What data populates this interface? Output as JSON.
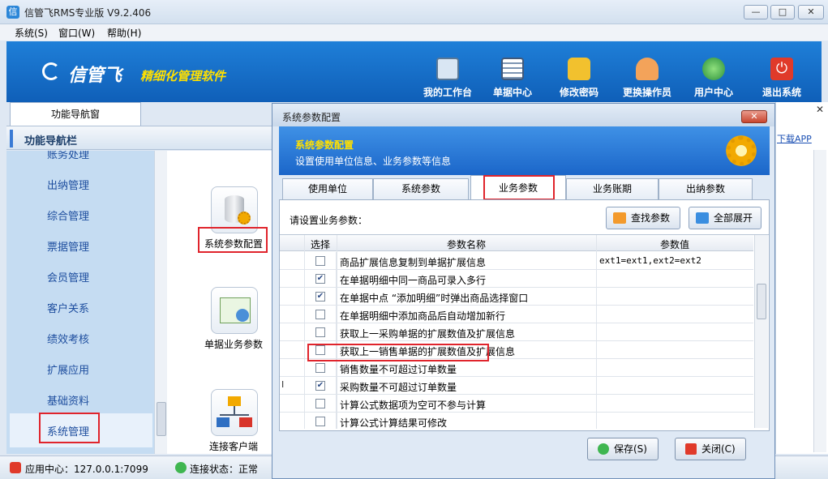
{
  "window": {
    "title": "信管飞RMS专业版 V9.2.406",
    "min_label": "—",
    "max_label": "□",
    "close_label": "✕"
  },
  "menu": [
    "系统(S)",
    "窗口(W)",
    "帮助(H)"
  ],
  "banner": {
    "brand": "信管飞",
    "slogan": "精细化管理软件",
    "buttons": [
      {
        "label": "我的工作台",
        "icon": "monitor-icon",
        "color": "#d9e6f3"
      },
      {
        "label": "单据中心",
        "icon": "document-list-icon",
        "color": "#e8edf3"
      },
      {
        "label": "修改密码",
        "icon": "lock-icon",
        "color": "#f2c12e"
      },
      {
        "label": "更换操作员",
        "icon": "user-icon",
        "color": "#f3a35a"
      },
      {
        "label": "用户中心",
        "icon": "globe-icon",
        "color": "#3fb650"
      },
      {
        "label": "退出系统",
        "icon": "power-icon",
        "color": "#e03a2a"
      }
    ]
  },
  "left_panel": {
    "tab_label": "功能导航窗",
    "header": "功能导航栏",
    "nav_items": [
      "账务处理",
      "出纳管理",
      "综合管理",
      "票据管理",
      "会员管理",
      "客户关系",
      "绩效考核",
      "扩展应用",
      "基础资料",
      "系统管理"
    ],
    "selected_index": 9,
    "functions": [
      {
        "label": "系统参数配置",
        "icon": "database-gear-icon"
      },
      {
        "label": "单据业务参数",
        "icon": "form-settings-icon"
      },
      {
        "label": "连接客户端",
        "icon": "network-icon"
      }
    ]
  },
  "right_panel": {
    "close_label": "✕",
    "download_link": "下载APP"
  },
  "status": {
    "app_center": "应用中心：127.0.0.1:7099",
    "conn_status": "连接状态：正常"
  },
  "dialog": {
    "title": "系统参数配置",
    "close_label": "✕",
    "header_title": "系统参数配置",
    "header_sub": "设置使用单位信息、业务参数等信息",
    "tabs": [
      "使用单位",
      "系统参数",
      "业务参数",
      "业务账期",
      "出纳参数"
    ],
    "active_tab": 2,
    "prompt": "请设置业务参数：",
    "find_btn": "查找参数",
    "expand_btn": "全部展开",
    "columns": {
      "select": "选择",
      "name": "参数名称",
      "value": "参数值"
    },
    "rows": [
      {
        "checked": false,
        "name": "商品扩展信息复制到单据扩展信息",
        "value": "ext1=ext1,ext2=ext2"
      },
      {
        "checked": true,
        "name": "在单据明细中同一商品可录入多行",
        "value": ""
      },
      {
        "checked": true,
        "name": "在单据中点 “添加明细”时弹出商品选择窗口",
        "value": ""
      },
      {
        "checked": false,
        "name": "在单据明细中添加商品后自动增加新行",
        "value": ""
      },
      {
        "checked": false,
        "name": "获取上一采购单据的扩展数值及扩展信息",
        "value": ""
      },
      {
        "checked": false,
        "name": "获取上一销售单据的扩展数值及扩展信息",
        "value": ""
      },
      {
        "checked": false,
        "name": "销售数量不可超过订单数量",
        "value": ""
      },
      {
        "checked": true,
        "name": "采购数量不可超过订单数量",
        "value": ""
      },
      {
        "checked": false,
        "name": "计算公式数据项为空可不参与计算",
        "value": ""
      },
      {
        "checked": false,
        "name": "计算公式计算结果可修改",
        "value": ""
      }
    ],
    "row_marker": "I",
    "save_btn": "保存(S)",
    "close_btn": "关闭(C)"
  }
}
